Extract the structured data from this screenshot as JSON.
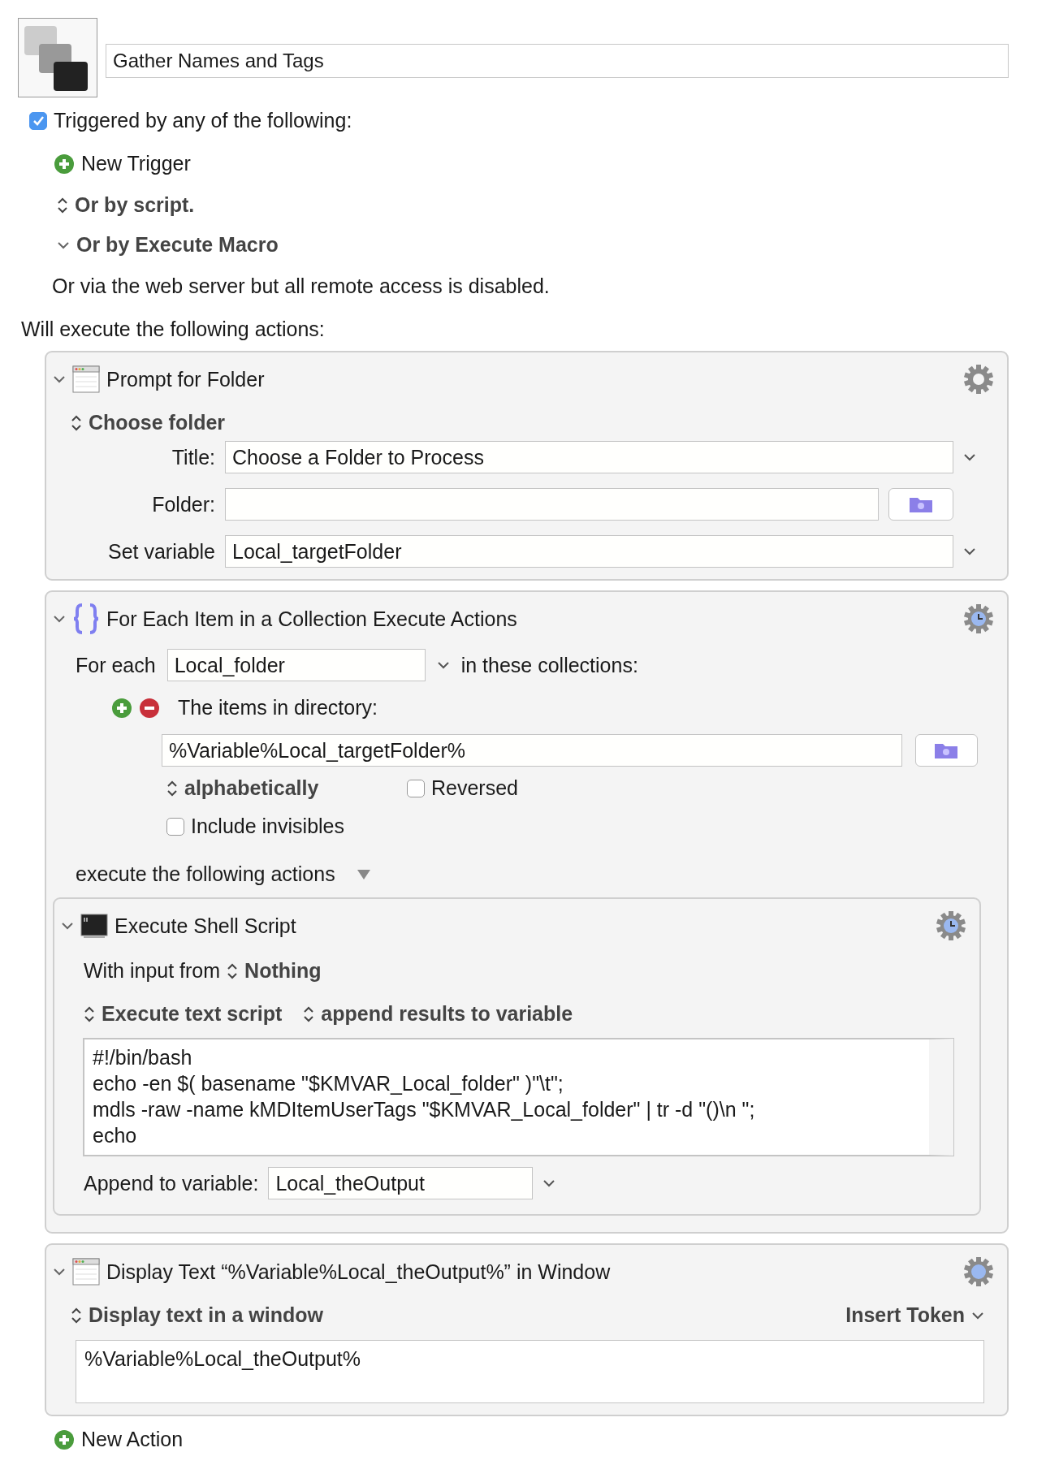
{
  "macro": {
    "name": "Gather Names and Tags"
  },
  "triggers": {
    "enabled": true,
    "label": "Triggered by any of the following:",
    "new_trigger": "New Trigger",
    "options": [
      {
        "label": "Or by script.",
        "kind": "popup"
      },
      {
        "label": "Or by Execute Macro",
        "kind": "disclosure"
      }
    ],
    "note": "Or via the web server but all remote access is disabled."
  },
  "actions_heading": "Will execute the following actions:",
  "actions": [
    {
      "kind": "prompt_folder",
      "title": "Prompt for Folder",
      "expanded": true,
      "mode": "Choose folder",
      "fields": [
        {
          "label": "Title:",
          "value": "Choose a Folder to Process",
          "kind": "dropdown"
        },
        {
          "label": "Folder:",
          "kind": "folder"
        },
        {
          "label": "Set variable",
          "value": "Local_targetFolder",
          "kind": "dropdown"
        }
      ]
    },
    {
      "kind": "for_each",
      "title": "For Each Item in a Collection Execute Actions",
      "expanded": true,
      "for_each_label": "For each",
      "variable": "Local_folder",
      "collections_label": "in these collections:",
      "collection": {
        "label": "The items in directory:",
        "path": "%Variable%Local_targetFolder%",
        "sort": "alphabetically"
      },
      "options": [
        {
          "label": "Reversed",
          "checked": false
        },
        {
          "label": "Include invisibles",
          "checked": false
        }
      ],
      "execute_label": "execute the following actions",
      "actions": [
        {
          "kind": "shell_script",
          "title": "Execute Shell Script",
          "expanded": true,
          "input_label": "With input from",
          "input": "Nothing",
          "source": "Execute text script",
          "output": "append results to variable",
          "script": [
            "#!/bin/bash",
            "echo -en $( basename \"$KMVAR_Local_folder\" )\"\\t\";",
            "mdls -raw -name kMDItemUserTags \"$KMVAR_Local_folder\" | tr -d \"()\\n \";",
            "echo"
          ],
          "append_label": "Append to variable:",
          "append_variable": "Local_theOutput"
        }
      ]
    },
    {
      "kind": "display_text",
      "title": "Display Text “%Variable%Local_theOutput%” in Window",
      "expanded": true,
      "mode": "Display text in a window",
      "insert_token": "Insert Token",
      "text": "%Variable%Local_theOutput%"
    }
  ],
  "new_action": "New Action"
}
